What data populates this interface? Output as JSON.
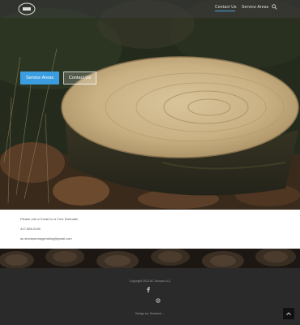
{
  "nav": {
    "logo": "site-logo",
    "links": [
      {
        "label": "Contact Us",
        "active": true
      },
      {
        "label": "Service Areas",
        "active": false
      }
    ],
    "search_icon": "search-icon"
  },
  "hero": {
    "buttons": [
      {
        "label": "Service Areas"
      },
      {
        "label": "Contact Us"
      }
    ]
  },
  "contact": {
    "call_text": "Please call or Email for a Free Estimate!",
    "phone": "417-555-0199",
    "email": "ac.stumpstumpgrinding@gmail.com"
  },
  "footer": {
    "copyright": "Copyright 2023 AC Stumps LLC",
    "social": [
      "facebook-icon",
      "map-pin-icon"
    ],
    "credit_prefix": "Design by: Smartest",
    "credit_link": "...",
    "to_top_icon": "chevron-up-icon"
  },
  "colors": {
    "accent": "#3b9de0",
    "nav_bg": "#3c3c3c",
    "footer_bg": "#2a2a2a",
    "content_bg": "#ffffff"
  }
}
